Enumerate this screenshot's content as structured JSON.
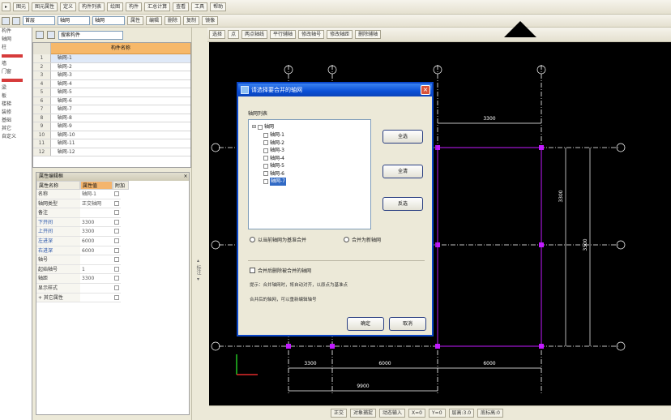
{
  "toolbar1": [
    "▸",
    "图元",
    "图元属性",
    "定义",
    "构件列表",
    "绘图",
    "构件",
    "汇总计算",
    "查看",
    "工具",
    "帮助"
  ],
  "toolbar2": {
    "floor_combo": "首层",
    "type_combo": "轴网",
    "sub_combo": "轴网",
    "buttons": [
      "属性",
      "编辑",
      "删除",
      "复制",
      "镜像"
    ]
  },
  "toolbar3": [
    "选择",
    "点",
    "两点轴线",
    "平行辅轴",
    "修改轴号",
    "修改轴距",
    "删除辅轴"
  ],
  "left_strip": [
    "构件",
    "轴网",
    "柱",
    "墙",
    "门窗",
    "梁",
    "板",
    "楼梯",
    "装修",
    "基础",
    "其它",
    "自定义"
  ],
  "grid_panel": {
    "search_combo": "搜索构件",
    "header_num": "",
    "header_name": "构件名称",
    "rows": [
      {
        "num": "1",
        "name": "轴网-1"
      },
      {
        "num": "2",
        "name": "轴网-2"
      },
      {
        "num": "3",
        "name": "轴网-3"
      },
      {
        "num": "4",
        "name": "轴网-4"
      },
      {
        "num": "5",
        "name": "轴网-5"
      },
      {
        "num": "6",
        "name": "轴网-6"
      },
      {
        "num": "7",
        "name": "轴网-7"
      },
      {
        "num": "8",
        "name": "轴网-8"
      },
      {
        "num": "9",
        "name": "轴网-9"
      },
      {
        "num": "10",
        "name": "轴网-10"
      },
      {
        "num": "11",
        "name": "轴网-11"
      },
      {
        "num": "12",
        "name": "轴网-12"
      }
    ]
  },
  "prop_panel": {
    "title": "属性编辑框",
    "col_name": "属性名称",
    "col_value": "属性值",
    "col_add": "附加",
    "rows": [
      {
        "name": "名称",
        "value": "轴网-1"
      },
      {
        "name": "轴网类型",
        "value": "正交轴网"
      },
      {
        "name": "备注",
        "value": ""
      },
      {
        "name": "下开间",
        "value": "3300"
      },
      {
        "name": "上开间",
        "value": "3300"
      },
      {
        "name": "左进深",
        "value": "6000"
      },
      {
        "name": "右进深",
        "value": "6000"
      },
      {
        "name": "轴号",
        "value": ""
      },
      {
        "name": "起始轴号",
        "value": "1"
      },
      {
        "name": "轴距",
        "value": "3300"
      },
      {
        "name": "显示样式",
        "value": ""
      },
      {
        "name": "+ 其它属性",
        "value": ""
      }
    ]
  },
  "dialog": {
    "title": "请选择要合并的轴网",
    "group_label": "轴网列表",
    "tree_root": "轴网",
    "tree_items": [
      "轴网-1",
      "轴网-2",
      "轴网-3",
      "轴网-4",
      "轴网-5",
      "轴网-6",
      "轴网-7"
    ],
    "btn_a": "全选",
    "btn_b": "全清",
    "btn_c": "反选",
    "radio_1": "以当前轴网为基准合并",
    "radio_2": "合并为新轴网",
    "check_1": "合并后删除被合并的轴网",
    "note_1": "提示：合并轴网时，将自动对齐，以原点为基准点",
    "note_2": "合并后的轴网，可以重新编辑轴号",
    "ok": "确定",
    "cancel": "取消"
  },
  "cad": {
    "dim_labels": [
      "3300",
      "6000",
      "6000",
      "3300",
      "3300",
      "3300",
      "9900"
    ],
    "axis_marker_color": "#c21aff",
    "axis_line_color": "#ffffff"
  },
  "ruler_label": "▴ 标注 ▾",
  "status_bar": [
    "正交",
    "对象捕捉",
    "动态输入",
    "X=0",
    "Y=0",
    "层高:3.0",
    "底标高:0"
  ]
}
